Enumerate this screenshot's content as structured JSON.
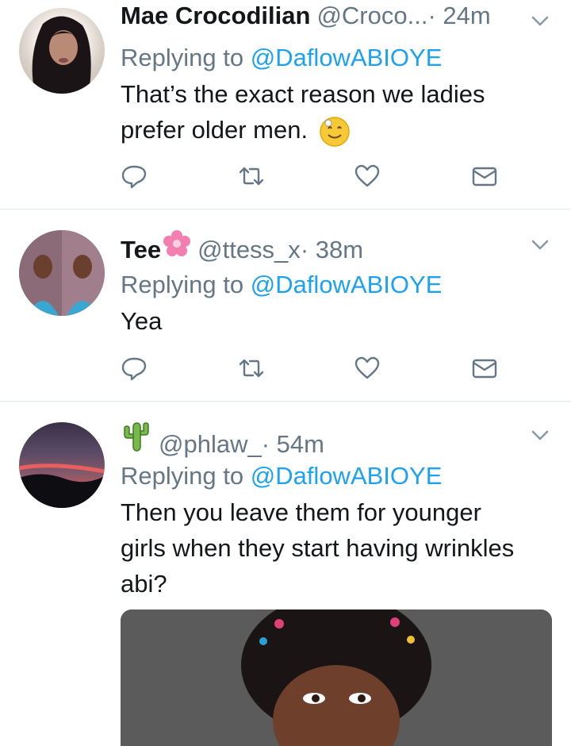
{
  "tweets": [
    {
      "name": "Mae Crocodilian",
      "handle": "@Croco...",
      "time": " · 24m",
      "reply_prefix": "Replying to ",
      "reply_to": "@DaflowABIOYE",
      "body": "That’s the exact reason we ladies prefer older men.",
      "emoji": "smiling-face-icon"
    },
    {
      "name": "Tee",
      "handle": "@ttess_x",
      "time": " · 38m",
      "reply_prefix": "Replying to ",
      "reply_to": "@DaflowABIOYE",
      "body": "Yea",
      "emoji": "flower-icon"
    },
    {
      "name": "",
      "handle": "@phlaw_",
      "time": " · 54m",
      "reply_prefix": "Replying to ",
      "reply_to": "@DaflowABIOYE",
      "body": "Then you leave them for younger girls when they start having wrinkles abi?",
      "emoji": "cactus-icon"
    }
  ],
  "colors": {
    "text": "#14171a",
    "secondary": "#657786",
    "link": "#1da1f2",
    "divider": "#e1e8ed"
  },
  "icons": [
    "reply-icon",
    "retweet-icon",
    "like-icon",
    "dm-icon",
    "chevron-down-icon"
  ]
}
